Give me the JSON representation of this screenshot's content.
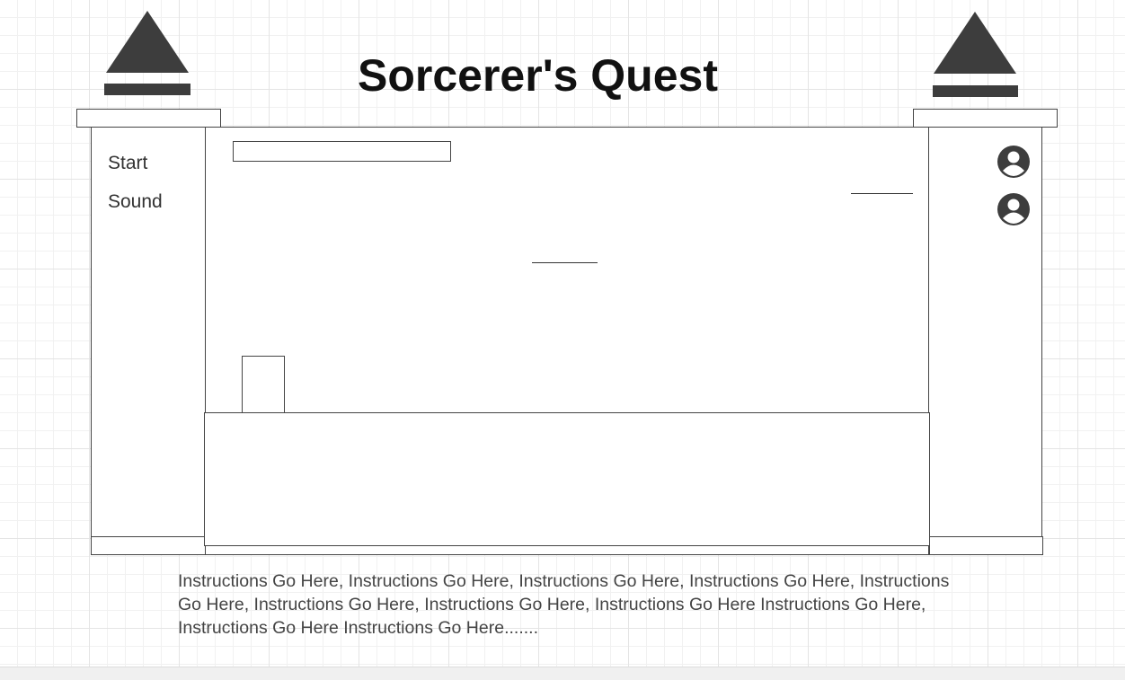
{
  "header": {
    "title": "Sorcerer's Quest"
  },
  "left_menu": {
    "items": [
      {
        "label": "Start"
      },
      {
        "label": "Sound"
      }
    ]
  },
  "right_panel": {
    "icons": [
      "user-circle-icon",
      "user-circle-icon"
    ]
  },
  "instructions": "Instructions Go Here, Instructions Go Here, Instructions Go Here, Instructions Go Here, Instructions Go Here, Instructions Go Here, Instructions Go Here, Instructions Go Here Instructions Go Here, Instructions Go Here Instructions Go Here.......",
  "colors": {
    "ink": "#3d3d3d",
    "title": "#111111",
    "grid": "#e4e4e4"
  }
}
